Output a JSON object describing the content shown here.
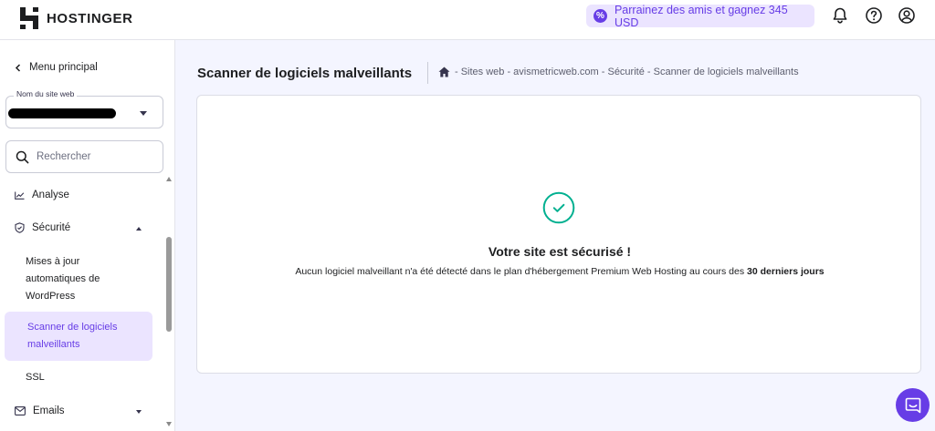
{
  "header": {
    "brand": "HOSTINGER",
    "referral_text": "Parrainez des amis et gagnez 345 USD",
    "icons": [
      "bell-icon",
      "help-icon",
      "account-icon"
    ]
  },
  "sidebar": {
    "back_label": "Menu principal",
    "site_select": {
      "label": "Nom du site web",
      "value": ""
    },
    "search": {
      "placeholder": "Rechercher"
    },
    "items": {
      "analyse": "Analyse",
      "securite": "Sécurité",
      "emails": "Emails"
    },
    "security_sub": {
      "updates_line1": "Mises à jour",
      "updates_line2": "automatiques de",
      "updates_line3": "WordPress",
      "scanner_line1": "Scanner de logiciels",
      "scanner_line2": "malveillants",
      "ssl": "SSL"
    }
  },
  "main": {
    "title": "Scanner de logiciels malveillants",
    "breadcrumb": "- Sites web - avismetricweb.com - Sécurité - Scanner de logiciels malveillants",
    "status_title": "Votre site est sécurisé !",
    "status_desc_prefix": "Aucun logiciel malveillant n'a été détecté dans le plan d'hébergement Premium Web Hosting au cours des",
    "status_desc_bold": "30 derniers jours"
  },
  "colors": {
    "accent": "#673de6",
    "accent_light": "#ebe4ff",
    "success": "#00b090",
    "background": "#f4f5ff"
  }
}
